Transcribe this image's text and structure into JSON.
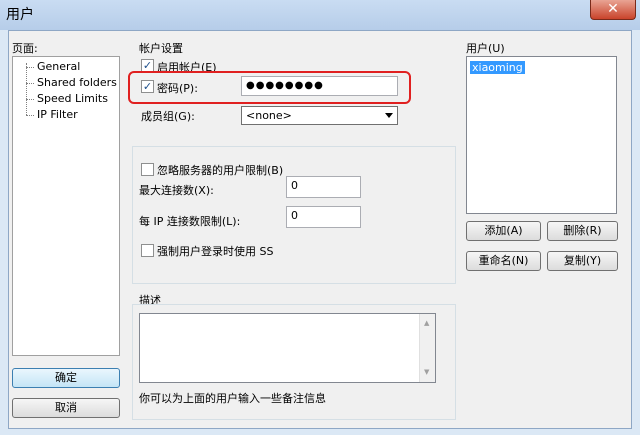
{
  "window": {
    "title": "用户",
    "close_glyph": "✕"
  },
  "left": {
    "pages_label": "页面:",
    "pages": [
      "General",
      "Shared folders",
      "Speed Limits",
      "IP Filter"
    ],
    "ok_label": "确定",
    "cancel_label": "取消"
  },
  "account": {
    "group_label": "帐户设置",
    "enable_label": "启用帐户(E)",
    "enable_checked": true,
    "password_label": "密码(P):",
    "password_checked": true,
    "password_value": "●●●●●●●●",
    "member_label": "成员组(G):",
    "member_value": "<none>"
  },
  "limits": {
    "bypass_label": "忽略服务器的用户限制(B)",
    "bypass_checked": false,
    "max_conn_label": "最大连接数(X):",
    "max_conn_value": "0",
    "ip_conn_label": "每 IP 连接数限制(L):",
    "ip_conn_value": "0",
    "force_ssl_label": "强制用户登录时使用 SS",
    "force_ssl_checked": false
  },
  "description": {
    "label": "描述",
    "hint": "你可以为上面的用户输入一些备注信息"
  },
  "users": {
    "label": "用户(U)",
    "items": [
      "xiaoming"
    ],
    "add_label": "添加(A)",
    "remove_label": "删除(R)",
    "rename_label": "重命名(N)",
    "copy_label": "复制(Y)"
  },
  "colors": {
    "highlight": "#e02020",
    "selection": "#3399ff"
  }
}
